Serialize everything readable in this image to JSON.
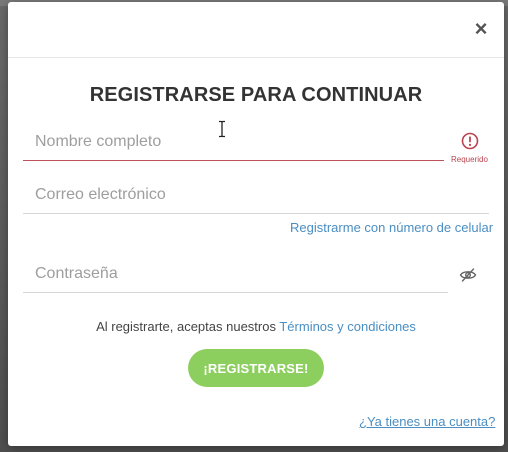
{
  "modal": {
    "title": "REGISTRARSE PARA CONTINUAR",
    "close_label": "×"
  },
  "form": {
    "name": {
      "placeholder": "Nombre completo",
      "value": "",
      "error": "Requerido"
    },
    "email": {
      "placeholder": "Correo electrónico",
      "value": ""
    },
    "phone_link": "Registrarme con número de celular",
    "password": {
      "placeholder": "Contraseña",
      "value": ""
    }
  },
  "terms": {
    "prefix": "Al registrarte, aceptas nuestros ",
    "link": "Términos y condiciones"
  },
  "register_label": "¡REGISTRARSE!",
  "login_link": "¿Ya tienes una cuenta?",
  "icons": {
    "close": "close-icon",
    "error": "alert-circle-icon",
    "password_toggle": "eye-slash-icon"
  },
  "colors": {
    "accent_link": "#4a8ec2",
    "button": "#8dcf5f",
    "error": "#b94450"
  }
}
